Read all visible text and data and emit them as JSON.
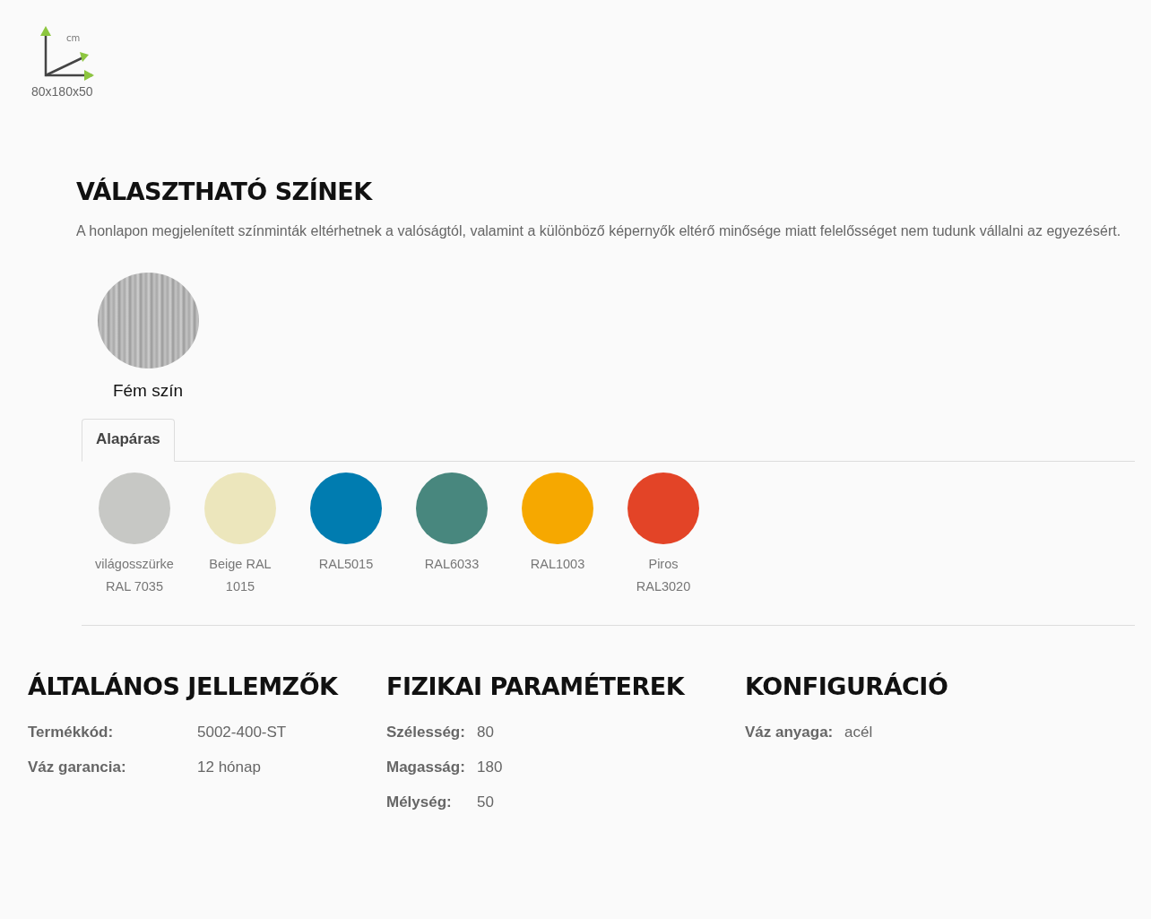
{
  "dimensions": {
    "unit": "cm",
    "value": "80x180x50"
  },
  "colors_section": {
    "title": "VÁLASZTHATÓ SZÍNEK",
    "note": "A honlapon megjelenített színminták eltérhetnek a valóságtól, valamint a különböző képernyők eltérő minősége miatt felelősséget nem tudunk vállalni az egyezésért.",
    "frame_color": {
      "label": "Fém szín"
    },
    "tabs": [
      {
        "label": "Alapáras",
        "selected": true
      }
    ],
    "swatches": [
      {
        "label": "világosszürke RAL 7035",
        "color": "#c7c8c5"
      },
      {
        "label": "Beige RAL 1015",
        "color": "#ece6bc"
      },
      {
        "label": "RAL5015",
        "color": "#007cb0"
      },
      {
        "label": "RAL6033",
        "color": "#48877e"
      },
      {
        "label": "RAL1003",
        "color": "#f6a800"
      },
      {
        "label": "Piros RAL3020",
        "color": "#e34427"
      }
    ]
  },
  "specs": [
    {
      "title": "ÁLTALÁNOS JELLEMZŐK",
      "rows": [
        {
          "label": "Termékkód:",
          "value": "5002-400-ST"
        },
        {
          "label": "Váz garancia:",
          "value": "12 hónap"
        }
      ]
    },
    {
      "title": "FIZIKAI PARAMÉTEREK",
      "rows": [
        {
          "label": "Szélesség:",
          "value": "80"
        },
        {
          "label": "Magasság:",
          "value": "180"
        },
        {
          "label": "Mélység:",
          "value": "50"
        }
      ]
    },
    {
      "title": "KONFIGURÁCIÓ",
      "rows": [
        {
          "label": "Váz anyaga:",
          "value": "acél"
        }
      ]
    }
  ]
}
